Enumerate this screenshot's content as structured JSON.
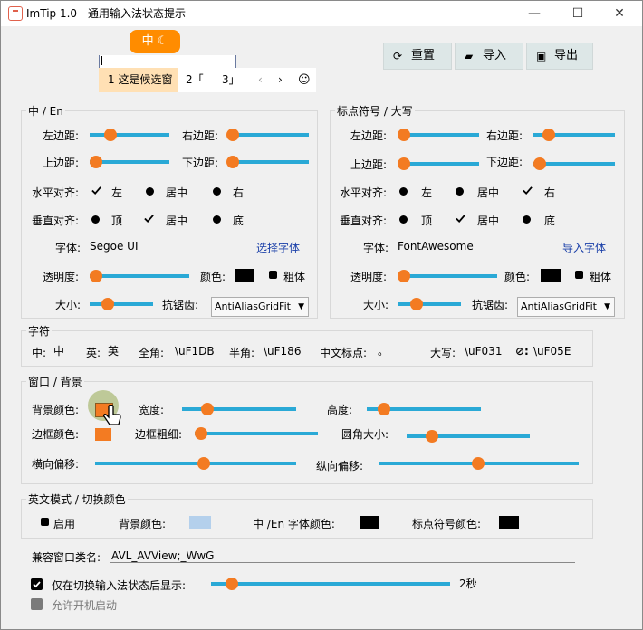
{
  "window": {
    "title": "ImTip 1.0 - 通用输入法状态提示",
    "minimize_icon": "minimize-icon",
    "maximize_icon": "maximize-icon",
    "close_icon": "close-icon"
  },
  "preview": {
    "status_pill": "中 ☾",
    "preedit_text": "",
    "candidates": [
      {
        "label": "1 这是候选窗"
      },
      {
        "label": "2「"
      },
      {
        "label": "3」"
      }
    ],
    "prev": "‹",
    "next": "›",
    "emoji": "☺"
  },
  "toolbar": {
    "reset": "重置",
    "import": "导入",
    "export": "导出"
  },
  "group_zh": {
    "title": "中 / En",
    "left_margin": "左边距:",
    "right_margin": "右边距:",
    "top_margin": "上边距:",
    "bottom_margin": "下边距:",
    "h_align": "水平对齐:",
    "h_left": "左",
    "h_center": "居中",
    "h_right": "右",
    "v_align": "垂直对齐:",
    "v_top": "顶",
    "v_center": "居中",
    "v_bottom": "底",
    "font_label": "字体:",
    "font_value": "Segoe UI",
    "font_link": "选择字体",
    "opacity": "透明度:",
    "color": "颜色:",
    "bold": "粗体",
    "size": "大小:",
    "aa": "抗锯齿:",
    "aa_value": "AntiAliasGridFit"
  },
  "group_punct": {
    "title": "标点符号 / 大写",
    "left_margin": "左边距:",
    "right_margin": "右边距:",
    "top_margin": "上边距:",
    "bottom_margin": "下边距:",
    "h_align": "水平对齐:",
    "h_left": "左",
    "h_center": "居中",
    "h_right": "右",
    "v_align": "垂直对齐:",
    "v_top": "顶",
    "v_center": "居中",
    "v_bottom": "底",
    "font_label": "字体:",
    "font_value": "FontAwesome",
    "font_link": "导入字体",
    "opacity": "透明度:",
    "color": "颜色:",
    "bold": "粗体",
    "size": "大小:",
    "aa": "抗锯齿:",
    "aa_value": "AntiAliasGridFit"
  },
  "chars": {
    "title": "字符",
    "zh_label": "中:",
    "zh_value": "中",
    "en_label": "英:",
    "en_value": "英",
    "full_label": "全角:",
    "full_value": "\\uF1DB",
    "half_label": "半角:",
    "half_value": "\\uF186",
    "punct_label": "中文标点:",
    "punct_value": "。",
    "caps_label": "大写:",
    "caps_value": "\\uF031",
    "sym_label": "⊘:",
    "sym_value": "\\uF05E"
  },
  "win_bg": {
    "title": "窗口 / 背景",
    "bg_color": "背景颜色:",
    "width": "宽度:",
    "height": "高度:",
    "border_color": "边框颜色:",
    "border_width": "边框粗细:",
    "radius": "圆角大小:",
    "h_offset": "横向偏移:",
    "v_offset": "纵向偏移:"
  },
  "en_mode": {
    "title": "英文模式 / 切换颜色",
    "enable": "启用",
    "bg_color": "背景颜色:",
    "font_color": "中 /En 字体颜色:",
    "punct_color": "标点符号颜色:"
  },
  "compat": {
    "label": "兼容窗口类名:",
    "value": "AVL_AVView;_WwG"
  },
  "options": {
    "show_after_switch": "仅在切换输入法状态后显示:",
    "duration": "2秒",
    "autostart": "允许开机启动"
  },
  "colors": {
    "accent": "#f37b22",
    "track": "#2aa9d6",
    "pill": "#ff8c00",
    "cand_sel": "#ffe0b4",
    "en_bg": "#b4d0ec"
  }
}
